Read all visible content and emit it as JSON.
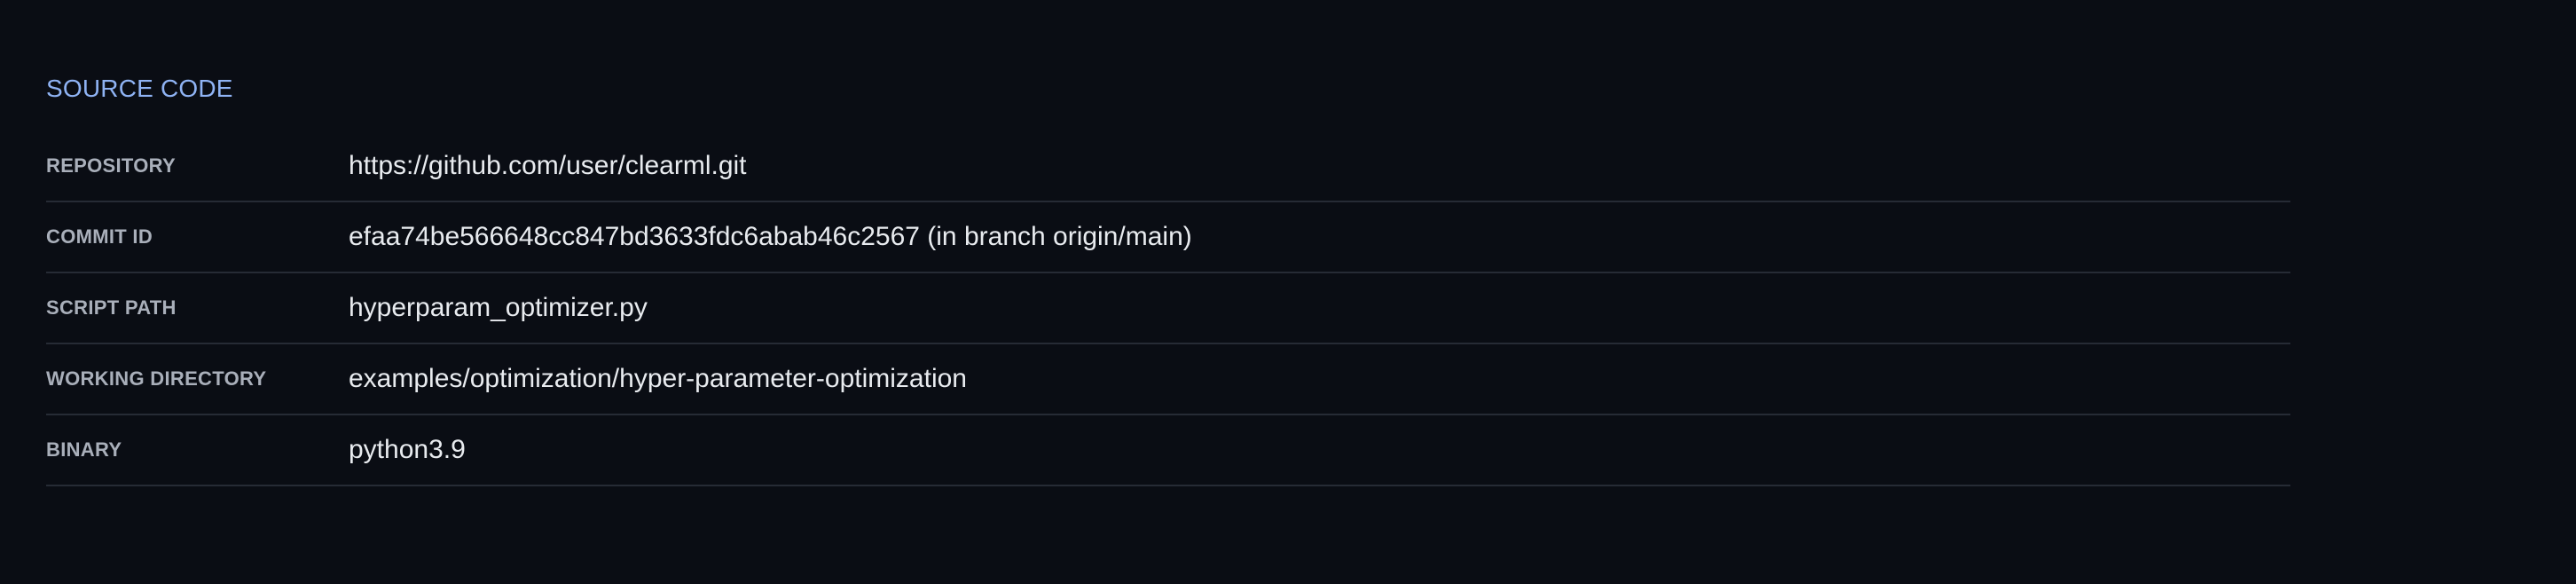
{
  "section": {
    "title": "SOURCE CODE"
  },
  "fields": [
    {
      "label": "REPOSITORY",
      "value": "https://github.com/user/clearml.git"
    },
    {
      "label": "COMMIT ID",
      "value": "efaa74be566648cc847bd3633fdc6abab46c2567 (in branch origin/main)"
    },
    {
      "label": "SCRIPT PATH",
      "value": "hyperparam_optimizer.py"
    },
    {
      "label": "WORKING DIRECTORY",
      "value": "examples/optimization/hyper-parameter-optimization"
    },
    {
      "label": "BINARY",
      "value": "python3.9"
    }
  ],
  "colors": {
    "background": "#0a0d14",
    "section_title": "#8fb3f4",
    "label": "#a9afba",
    "value": "#e8ebef",
    "divider": "#262b35"
  }
}
